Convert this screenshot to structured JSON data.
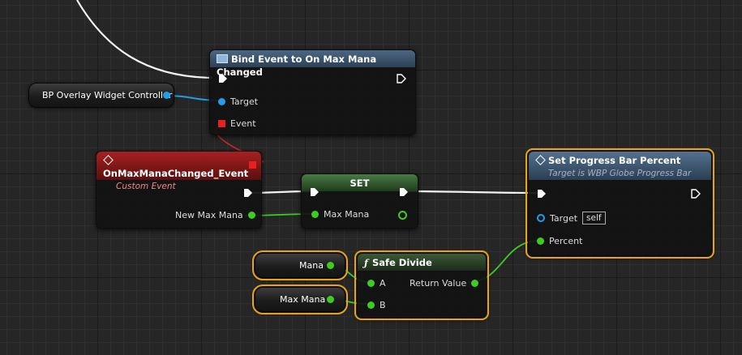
{
  "nodes": {
    "bind_event": {
      "title": "Bind Event to On Max Mana Changed",
      "target_label": "Target",
      "event_label": "Event"
    },
    "bp_overlay": {
      "label": "BP Overlay Widget Controller"
    },
    "custom_event": {
      "title": "OnMaxManaChanged_Event",
      "subtitle": "Custom Event",
      "out_label": "New Max Mana"
    },
    "set_node": {
      "title": "SET",
      "in_label": "Max Mana"
    },
    "set_progress": {
      "title": "Set Progress Bar Percent",
      "subtitle": "Target is WBP Globe Progress Bar",
      "target_label": "Target",
      "target_value": "self",
      "percent_label": "Percent"
    },
    "mana_var": {
      "label": "Mana"
    },
    "max_mana_var": {
      "label": "Max Mana"
    },
    "safe_divide": {
      "title": "Safe Divide",
      "a_label": "A",
      "b_label": "B",
      "return_label": "Return Value"
    }
  },
  "colors": {
    "exec": "#ffffff",
    "object": "#1e9fe8",
    "float": "#3fcc22",
    "delegate": "#e8211e",
    "selection": "#e8a21e"
  }
}
